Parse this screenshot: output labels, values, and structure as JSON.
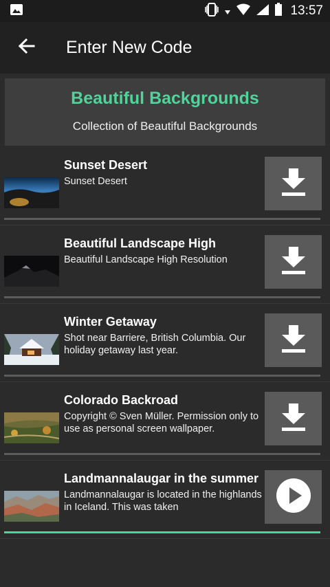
{
  "status": {
    "time": "13:57",
    "icons": [
      "image-icon",
      "vibrate-icon",
      "data-arrows-icon",
      "wifi-icon",
      "signal-icon",
      "battery-icon"
    ]
  },
  "appbar": {
    "title": "Enter New Code",
    "back_icon": "arrow-left-icon"
  },
  "header": {
    "title": "Beautiful Backgrounds",
    "subtitle": "Collection of Beautiful Backgrounds",
    "accent": "#4fd49a"
  },
  "items": [
    {
      "title": "Sunset Desert",
      "description": "Sunset Desert",
      "action_icon": "download-icon"
    },
    {
      "title": "Beautiful Landscape High",
      "description": "Beautiful Landscape High Resolution",
      "action_icon": "download-icon"
    },
    {
      "title": "Winter Getaway",
      "description": "Shot near Barriere, British Columbia. Our holiday getaway last year.",
      "action_icon": "download-icon"
    },
    {
      "title": "Colorado Backroad",
      "description": "Copyright © Sven Müller. Permission only to use as personal screen wallpaper.",
      "action_icon": "download-icon"
    },
    {
      "title": "Landmannalaugar in the summer",
      "description": "Landmannalaugar is located in the highlands in Iceland. This was taken",
      "action_icon": "play-icon"
    }
  ]
}
